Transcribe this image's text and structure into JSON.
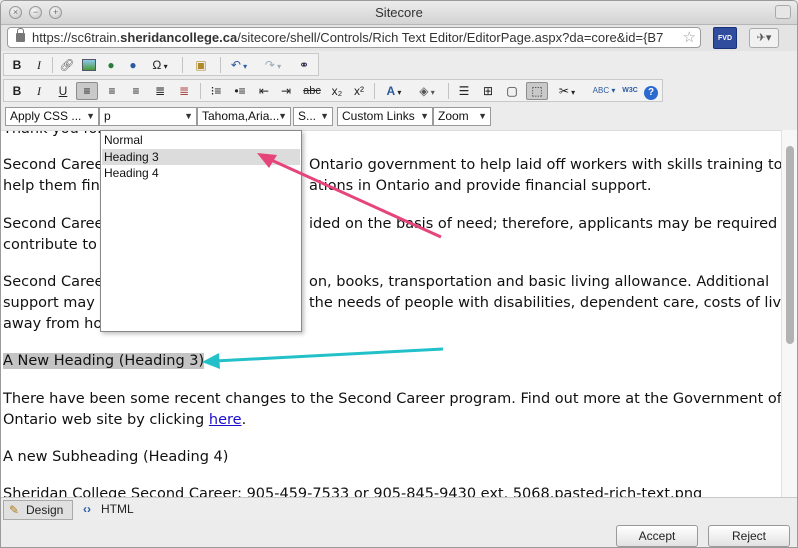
{
  "window": {
    "title": "Sitecore",
    "url": "https://sc6train.sheridancollege.ca/sitecore/shell/Controls/Rich Text Editor/EditorPage.aspx?da=core&id={B7",
    "url_host_bold": "sheridancollege.ca",
    "url_prefix": "https://sc6train.",
    "url_suffix": "/sitecore/shell/Controls/Rich Text Editor/EditorPage.aspx?da=core&id={B7",
    "fvd_label": "FVD"
  },
  "toolbar1": {
    "bold": "B",
    "italic": "I",
    "omega": "Ω",
    "find": "⚲"
  },
  "toolbar2": {
    "bold": "B",
    "italic": "I",
    "underline": "U",
    "strike": "abc",
    "sub": "x₂",
    "sup": "x²",
    "font_color": "A",
    "spell": "ABC",
    "w3c": "W3C",
    "help": "?"
  },
  "toolbar3": {
    "css_class": "Apply CSS ...",
    "paragraph": "p",
    "font": "Tahoma,Aria...",
    "size": "S...",
    "links": "Custom Links",
    "zoom": "Zoom"
  },
  "dropdown": {
    "options": [
      "Normal",
      "Heading 3",
      "Heading 4"
    ],
    "selected": "Heading 3"
  },
  "content": {
    "p0": "Thank you for ... Sheridan College.",
    "p1a": "Second Career",
    "p1b": "Ontario government to help laid off workers with skills training to",
    "p2a": "help them find",
    "p2b": "ations in Ontario and provide financial support.",
    "p3a": "Second Career",
    "p3b": "ided on the basis of need; therefore, applicants may be required to",
    "p4": "contribute to t",
    "p5a": "Second Career",
    "p5b": "on, books, transportation and basic living allowance.  Additional",
    "p6a": "support may b",
    "p6b": "the needs of people with disabilities, dependent care, costs of living",
    "p7": "away from ho",
    "heading3": "A New Heading (Heading 3)",
    "p8": "There have been some recent changes to the Second Career program.  Find out more at the Government of",
    "p9": "Ontario web site by clicking ",
    "link": "here",
    "p9end": ".",
    "heading4": "A new Subheading (Heading 4)",
    "p10": "Sheridan College Second Career:  905-459-7533 or 905-845-9430 ext. 5068.pasted-rich-text.png"
  },
  "modes": {
    "design": "Design",
    "html": "HTML"
  },
  "buttons": {
    "accept": "Accept",
    "reject": "Reject"
  },
  "colors": {
    "arrow_pink": "#e6457a",
    "arrow_cyan": "#22c1c9",
    "link": "#1a0dcc",
    "heading_highlight": "#c4c4c4"
  }
}
